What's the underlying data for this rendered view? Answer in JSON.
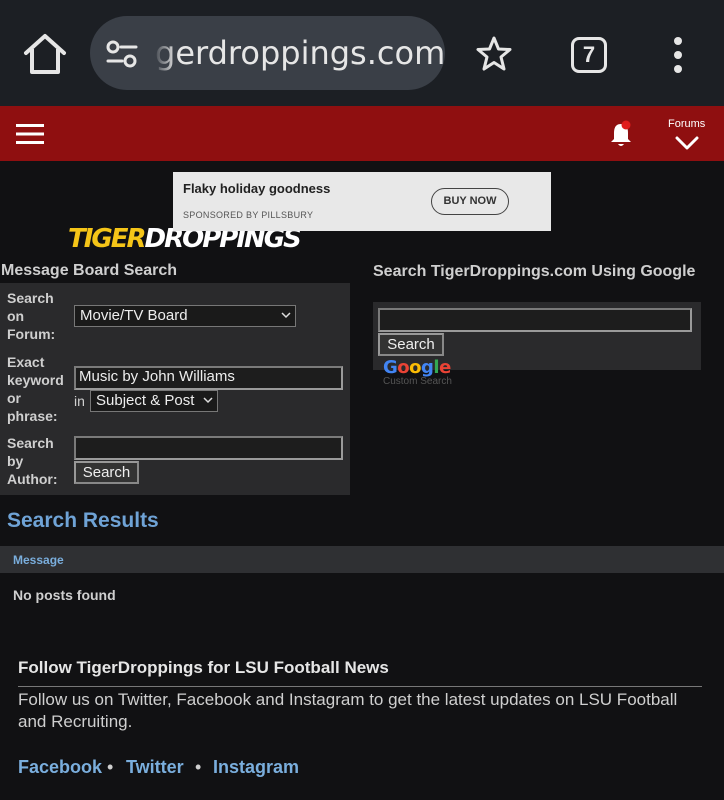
{
  "browser": {
    "url": "gerdroppings.com",
    "tab_count": "7"
  },
  "header": {
    "logo_part1": "TIGER",
    "logo_part2": "DROPPINGS",
    "forums_label": "Forums"
  },
  "ad": {
    "headline": "Flaky holiday goodness",
    "sponsor": "SPONSORED BY PILLSBURY",
    "button": "BUY NOW"
  },
  "board_search": {
    "title": "Message Board Search",
    "forum_label_lines": [
      "Search",
      "on",
      "Forum:"
    ],
    "forum_value": "Movie/TV Board",
    "keyword_label_lines": [
      "Exact",
      "keyword",
      "or",
      "phrase:"
    ],
    "keyword_value": "Music by John Williams",
    "in_label": "in",
    "scope_value": "Subject & Post",
    "author_label_lines": [
      "Search",
      "by",
      "Author:"
    ],
    "author_value": "",
    "search_button": "Search"
  },
  "google_search": {
    "title": "Search TigerDroppings.com Using Google",
    "query": "",
    "search_button": "Search",
    "custom_search_label": "Custom Search"
  },
  "results": {
    "title": "Search Results",
    "column_header": "Message",
    "empty_text": "No posts found"
  },
  "follow": {
    "title": "Follow TigerDroppings for LSU Football News",
    "text": "Follow us on Twitter, Facebook and Instagram to get the latest updates on LSU Football and Recruiting.",
    "links": [
      "Facebook",
      "Twitter",
      "Instagram"
    ],
    "separator": "•"
  },
  "colors": {
    "header_red": "#8f0f10",
    "link_blue": "#7aaedd",
    "logo_yellow": "#f5c518"
  }
}
